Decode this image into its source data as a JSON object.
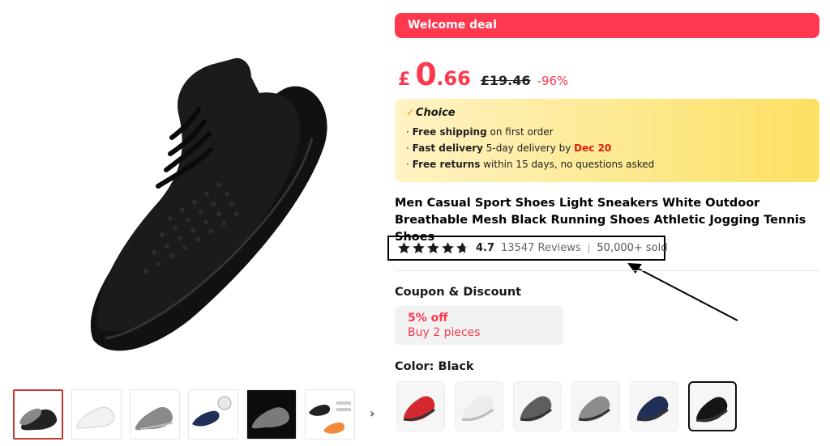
{
  "welcome_deal": "Welcome deal",
  "price": {
    "currency": "£",
    "integer": "0",
    "decimal": ".66",
    "original": "£19.46",
    "discount": "-96%"
  },
  "choice": {
    "title": "Choice",
    "lines": [
      {
        "bullet": "·",
        "bold": "Free shipping",
        "text": " on first order",
        "red": ""
      },
      {
        "bullet": "·",
        "bold": "Fast delivery",
        "text": " 5-day delivery by ",
        "red": "Dec 20"
      },
      {
        "bullet": "·",
        "bold": "Free returns",
        "text": "  within 15 days, no questions asked",
        "red": ""
      }
    ]
  },
  "product_title": "Men Casual Sport Shoes Light Sneakers White Outdoor Breathable Mesh Black Running Shoes Athletic Jogging Tennis Shoes",
  "rating": {
    "value": "4.7",
    "stars": 4.7,
    "reviews": "13547 Reviews",
    "separator": "|",
    "sold": "50,000+ sold"
  },
  "coupon": {
    "heading": "Coupon & Discount",
    "off": "5% off",
    "condition": "Buy 2 pieces"
  },
  "color": {
    "heading": "Color: Black",
    "selected_index": 5,
    "options": [
      {
        "name": "red",
        "hex": "#d5282f"
      },
      {
        "name": "white",
        "hex": "#ececec"
      },
      {
        "name": "dark-gray",
        "hex": "#5e5e5e"
      },
      {
        "name": "gray",
        "hex": "#8c8c8c"
      },
      {
        "name": "navy",
        "hex": "#1f2f55"
      },
      {
        "name": "black",
        "hex": "#151515"
      }
    ]
  },
  "gallery": {
    "next_icon": "›",
    "active_index": 0
  },
  "colors": {
    "accent": "#fd384f",
    "choice_check": "#f3a21a",
    "delivery_date": "#e3180b"
  }
}
